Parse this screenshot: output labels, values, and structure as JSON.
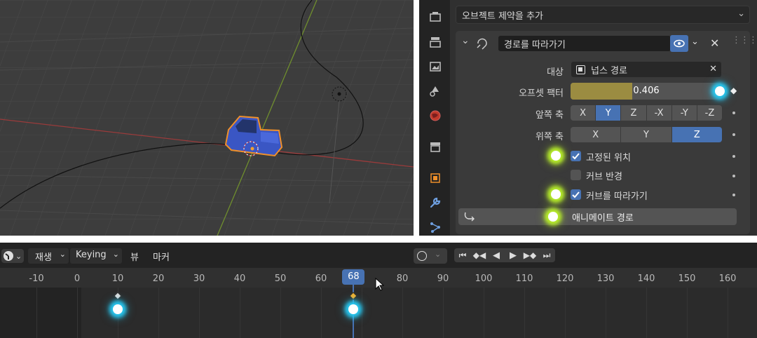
{
  "constraint_panel": {
    "add_constraint_label": "오브젝트 제약을 추가",
    "constraint_name": "경로를 따라가기",
    "target_label": "대상",
    "target_value": "넙스 경로",
    "offset_factor_label": "오프셋 팩터",
    "offset_factor_value": "0.406",
    "offset_factor_fraction": 0.406,
    "forward_axis_label": "앞쪽 축",
    "forward_axis_options": [
      "X",
      "Y",
      "Z",
      "-X",
      "-Y",
      "-Z"
    ],
    "forward_axis_selected": "Y",
    "up_axis_label": "위쪽 축",
    "up_axis_options": [
      "X",
      "Y",
      "Z"
    ],
    "up_axis_selected": "Z",
    "fixed_position_label": "고정된 위치",
    "fixed_position_checked": true,
    "curve_radius_label": "커브 반경",
    "curve_radius_checked": false,
    "follow_curve_label": "커브를 따라가기",
    "follow_curve_checked": true,
    "animate_path_label": "애니메이트 경로"
  },
  "timeline": {
    "menu_playback": "재생",
    "menu_keying": "Keying",
    "menu_view": "뷰",
    "menu_marker": "마커",
    "current_frame": "68",
    "ruler_ticks": [
      "-10",
      "0",
      "10",
      "20",
      "30",
      "40",
      "50",
      "60",
      "70",
      "80",
      "90",
      "100",
      "110",
      "120",
      "130",
      "140",
      "150",
      "160"
    ],
    "keyframes": [
      10,
      68
    ]
  },
  "icons": {
    "constraint_icon": "follow-path-icon",
    "visibility_icon": "eye-icon",
    "delete_icon": "x-icon",
    "drag_icon": "grip-icon"
  },
  "colors": {
    "accent_blue": "#4772b3",
    "selected_orange": "#f0902a",
    "offset_gold": "#9b8c41",
    "highlight_yellow": "#b8ef2a",
    "highlight_cyan": "#27c7f0"
  }
}
